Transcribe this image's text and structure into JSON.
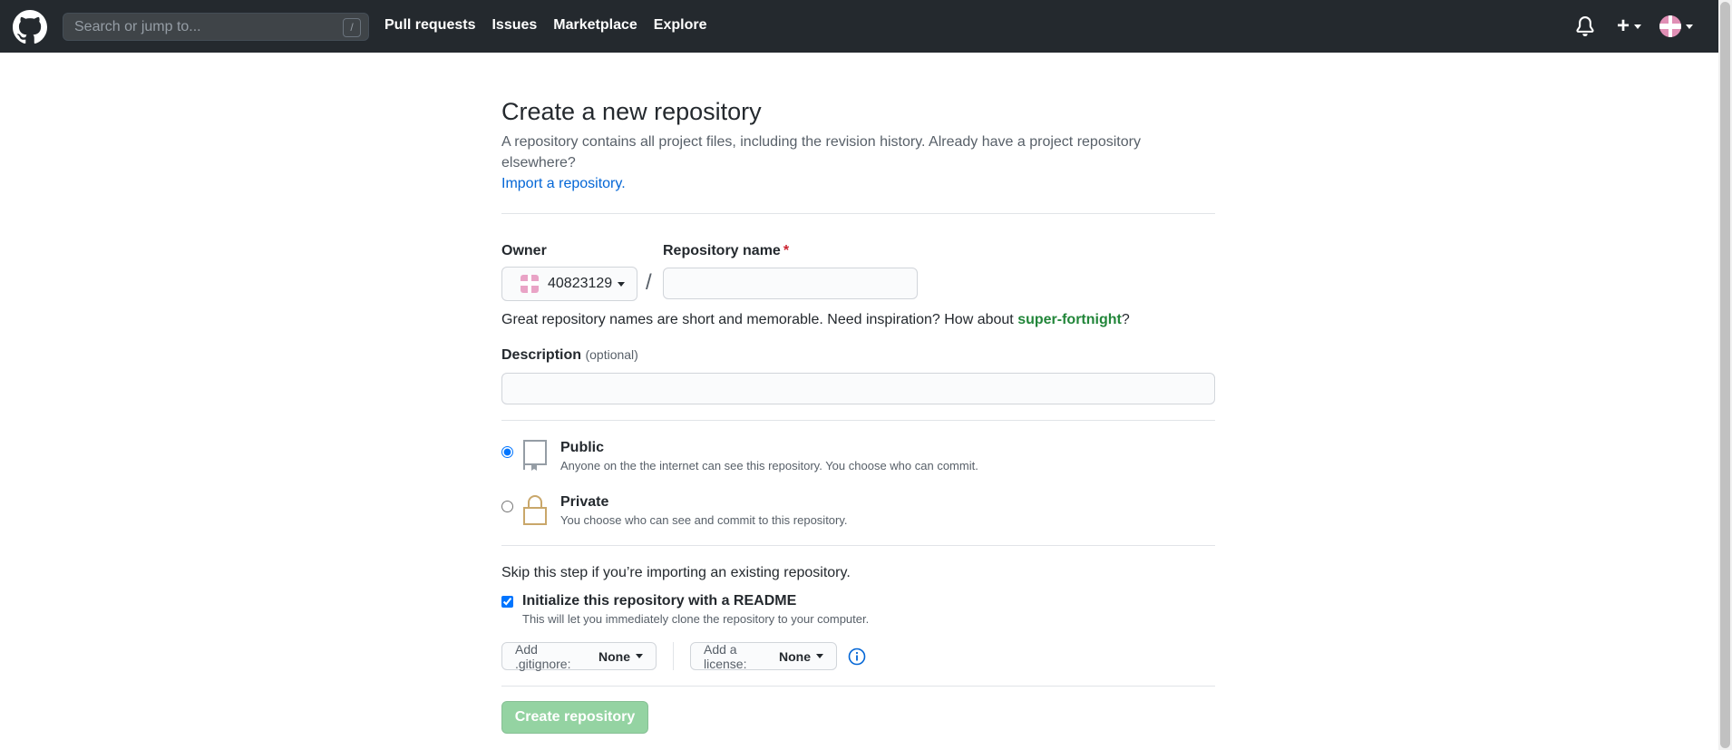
{
  "header": {
    "search_placeholder": "Search or jump to...",
    "search_key": "/",
    "nav": [
      "Pull requests",
      "Issues",
      "Marketplace",
      "Explore"
    ],
    "plus": "+"
  },
  "page": {
    "title": "Create a new repository",
    "subtitle": "A repository contains all project files, including the revision history. Already have a project repository elsewhere?",
    "import_link": "Import a repository."
  },
  "form": {
    "owner_label": "Owner",
    "repo_name_label": "Repository name",
    "required_mark": "*",
    "owner_value": "40823129",
    "slash": "/",
    "repo_name_value": "",
    "name_hint_prefix": "Great repository names are short and memorable. Need inspiration? How about ",
    "name_suggestion": "super-fortnight",
    "name_hint_suffix": "?",
    "description_label": "Description",
    "description_optional": "(optional)",
    "description_value": ""
  },
  "visibility": {
    "public_title": "Public",
    "public_desc": "Anyone on the the internet can see this repository. You choose who can commit.",
    "private_title": "Private",
    "private_desc": "You choose who can see and commit to this repository.",
    "selected": "public"
  },
  "init": {
    "skip_note": "Skip this step if you’re importing an existing repository.",
    "readme_label": "Initialize this repository with a README",
    "readme_desc": "This will let you immediately clone the repository to your computer.",
    "readme_checked": true,
    "gitignore_label": "Add .gitignore:",
    "gitignore_value": "None",
    "license_label": "Add a license:",
    "license_value": "None"
  },
  "submit": {
    "label": "Create repository"
  },
  "colors": {
    "header_bg": "#24292e",
    "link": "#0366d6",
    "suggest": "#22863a",
    "create_btn_disabled": "#94d3a2",
    "required": "#cb2431"
  }
}
